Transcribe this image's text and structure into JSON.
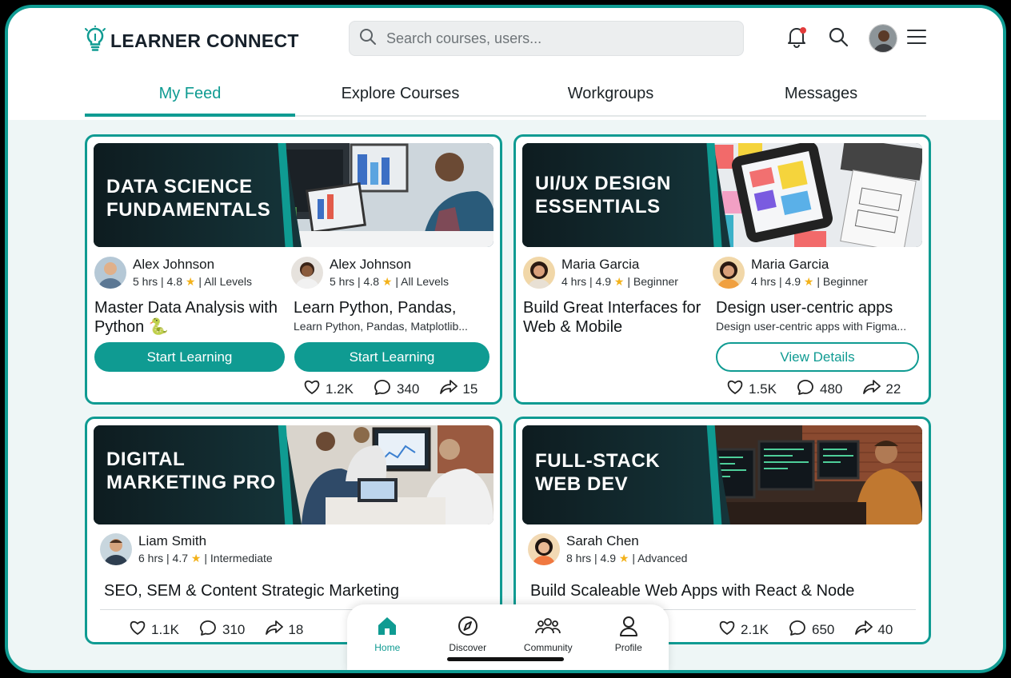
{
  "app": {
    "title": "LEARNER CONNECT"
  },
  "search": {
    "placeholder": "Search courses, users..."
  },
  "header_icons": [
    "bell-icon",
    "search-icon",
    "avatar",
    "menu-icon"
  ],
  "tabs": [
    {
      "label": "My Feed",
      "active": true
    },
    {
      "label": "Explore Courses",
      "active": false
    },
    {
      "label": "Workgroups",
      "active": false
    },
    {
      "label": "Messages",
      "active": false
    }
  ],
  "colors": {
    "accent": "#0f9b92",
    "notification": "#e23b3b",
    "star": "#f3b21b"
  },
  "cards": [
    {
      "banner_title": "DATA SCIENCE\nFUNDAMENTALS",
      "author_a": {
        "name": "Alex Johnson",
        "hours": "5 hrs",
        "rating": "4.8",
        "level": "All Levels"
      },
      "author_b": {
        "name": "Alex Johnson",
        "hours": "5 hrs",
        "rating": "4.8",
        "level": "All Levels"
      },
      "title_a": "Master Data Analysis with Python 🐍",
      "title_b": "Learn Python, Pandas,",
      "desc_b": "Learn Python, Pandas, Matplotlib...",
      "button_a": "Start Learning",
      "button_b": "Start Learning",
      "likes": "1.2K",
      "comments": "340",
      "shares": "15"
    },
    {
      "banner_title": "UI/UX DESIGN\nESSENTIALS",
      "author_a": {
        "name": "Maria Garcia",
        "hours": "4 hrs",
        "rating": "4.9",
        "level": "Beginner"
      },
      "author_b": {
        "name": "Maria Garcia",
        "hours": "4 hrs",
        "rating": "4.9",
        "level": "Beginner"
      },
      "title_a": "Build Great Interfaces for Web & Mobile",
      "title_b": "Design user-centric apps",
      "desc_b": "Design user-centric apps with Figma...",
      "button_b": "View Details",
      "likes": "1.5K",
      "comments": "480",
      "shares": "22"
    },
    {
      "banner_title": "DIGITAL\nMARKETING PRO",
      "author_a": {
        "name": "Liam Smith",
        "hours": "6 hrs",
        "rating": "4.7",
        "level": "Intermediate"
      },
      "title_a": "SEO, SEM & Content Strategic Marketing",
      "likes": "1.1K",
      "comments": "310",
      "shares": "18"
    },
    {
      "banner_title": "FULL-STACK\nWEB DEV",
      "author_a": {
        "name": "Sarah Chen",
        "hours": "8 hrs",
        "rating": "4.9",
        "level": "Advanced"
      },
      "title_a": "Build Scaleable Web Apps with React & Node",
      "likes": "2.1K",
      "comments": "650",
      "shares": "40"
    }
  ],
  "bottom_nav": [
    {
      "label": "Home",
      "icon": "home-icon",
      "active": true
    },
    {
      "label": "Discover",
      "icon": "compass-icon",
      "active": false
    },
    {
      "label": "Community",
      "icon": "community-icon",
      "active": false
    },
    {
      "label": "Profile",
      "icon": "profile-icon",
      "active": false
    }
  ]
}
